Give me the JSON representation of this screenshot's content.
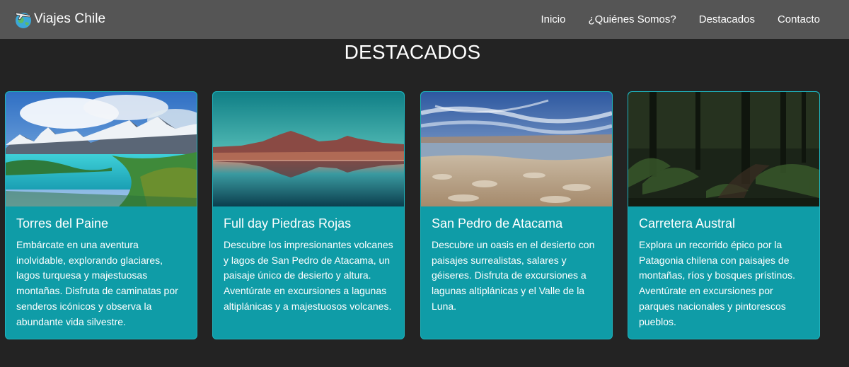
{
  "nav": {
    "brand": "Viajes Chile",
    "links": [
      "Inicio",
      "¿Quiénes Somos?",
      "Destacados",
      "Contacto"
    ]
  },
  "section": {
    "title": "DESTACADOS"
  },
  "cards": [
    {
      "title": "Torres del Paine",
      "text": "Embárcate en una aventura inolvidable, explorando glaciares, lagos turquesa y majestuosas montañas. Disfruta de caminatas por senderos icónicos y observa la abundante vida silvestre."
    },
    {
      "title": "Full day Piedras Rojas",
      "text": "Descubre los impresionantes volcanes y lagos de San Pedro de Atacama, un paisaje único de desierto y altura. Aventúrate en excursiones a lagunas altiplánicas y a majestuosos volcanes."
    },
    {
      "title": "San Pedro de Atacama",
      "text": "Descubre un oasis en el desierto con paisajes surrealistas, salares y géiseres. Disfruta de excursiones a lagunas altiplánicas y el Valle de la Luna."
    },
    {
      "title": "Carretera Austral",
      "text": "Explora un recorrido épico por la Patagonia chilena con paisajes de montañas, ríos y bosques prístinos. Aventúrate en excursiones por parques nacionales y pintorescos pueblos."
    }
  ],
  "colors": {
    "background": "#232323",
    "navbar": "#555555",
    "card": "#0f9ca7"
  }
}
